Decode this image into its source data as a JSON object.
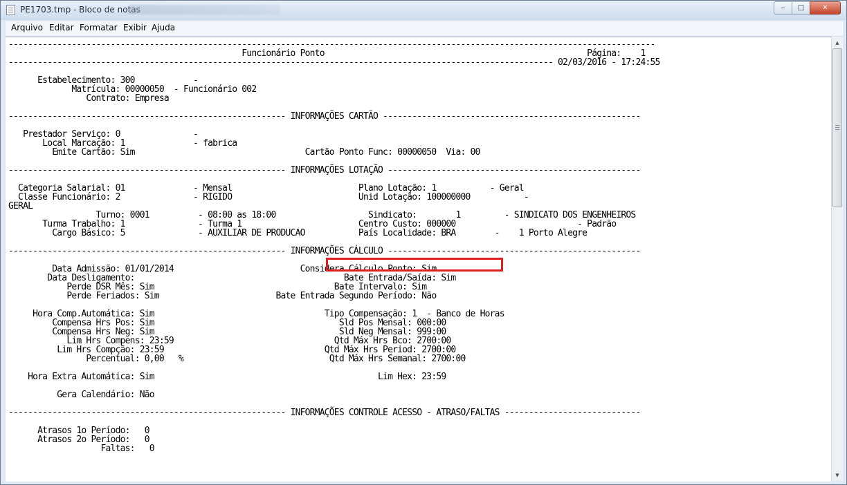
{
  "window": {
    "title": "PE1703.tmp - Bloco de notas",
    "min_label": "‒",
    "max_label": "□",
    "close_label": "✕"
  },
  "menu": [
    {
      "label": "Arquivo"
    },
    {
      "label": "Editar"
    },
    {
      "label": "Formatar"
    },
    {
      "label": "Exibir"
    },
    {
      "label": "Ajuda"
    }
  ],
  "scrollbar": {
    "up": "▲",
    "down": "▼"
  },
  "document": {
    "lines": [
      "-------------------------------------------------------------------------------------------------------------------------------------",
      "                                                Funcionário Ponto                                                      Página:    1",
      "---------------------------------------------------------------------------------------------------------------- 02/03/2016 - 17:24:55",
      "",
      "      Estabelecimento: 300            -",
      "             Matrícula: 00000050  - Funcionário 002",
      "                Contrato: Empresa",
      "",
      "--------------------------------------------------------- INFORMAÇÕES CARTÃO -----------------------------------------------------",
      "",
      "   Prestador Serviço: 0               -",
      "       Local Marcação: 1              - fabrica",
      "         Emite Cartão: Sim                                   Cartão Ponto Func: 00000050  Via: 00",
      "",
      "--------------------------------------------------------- INFORMAÇÕES LOTAÇÃO ----------------------------------------------------",
      "",
      "  Categoria Salarial: 01              - Mensal                          Plano Lotação: 1           - Geral",
      "  Classe Funcionário: 2               - RIGIDO                          Unid Lotação: 100000000           -",
      "GERAL",
      "                  Turno: 0001          - 08:00 as 18:00                   Sindicato:        1         - SINDICATO DOS ENGENHEIROS",
      "       Turma Trabalho: 1               - Turma 1                        Centro Custo: 000000                         - Padrão",
      "         Cargo Básico: 5               - AUXILIAR DE PRODUCAO           País Localidade: BRA        -    1 Porto Alegre",
      "",
      "--------------------------------------------------------- INFORMAÇÕES CÁLCULO ----------------------------------------------------",
      "",
      "         Data Admissão: 01/01/2014                          Considera Cálculo Ponto: Sim",
      "        Data Desligamento:                                           Bate Entrada/Saída: Sim",
      "            Perde DSR Mês: Sim                                     Bate Intervalo: Sim",
      "            Perde Feriados: Sim                        Bate Entrada Segundo Período: Não",
      "",
      "     Hora Comp.Automática: Sim                                   Tipo Compensação: 1  - Banco de Horas",
      "         Compensa Hrs Pos: Sim                                      Sld Pos Mensal: 000:00",
      "         Compensa Hrs Neg: Sim                                      Sld Neg Mensal: 999:00",
      "            Lim Hrs Compens: 23:59                                 Qtd Máx Hrs Bco: 2700:00",
      "          Lim Hrs Compção: 23:59                                 Qtd Máx Hrs Period: 2700:00",
      "                Percentual: 0,00   %                              Qtd Máx Hrs Semanal: 2700:00",
      "",
      "    Hora Extra Automática: Sim                                              Lim Hex: 23:59",
      "",
      "          Gera Calendário: Não",
      "",
      "--------------------------------------------------------- INFORMAÇÕES CONTROLE ACESSO - ATRASO/FALTAS ----------------------------",
      "",
      "      Atrasos 1o Período:   0",
      "      Atrasos 2o Período:   0",
      "                   Faltas:   0"
    ]
  },
  "highlight": {
    "label": "Considera Cálculo Ponto: Sim",
    "color": "#e02020"
  }
}
